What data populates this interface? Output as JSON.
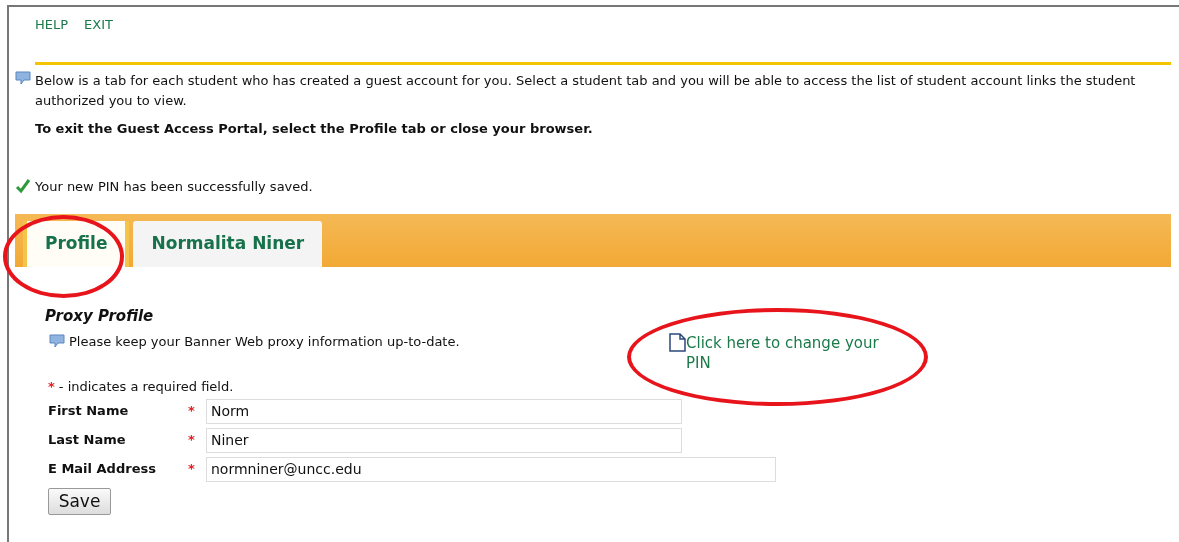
{
  "nav_links": [
    "HELP",
    "EXIT"
  ],
  "intro": "Below is a tab for each student who has created a guest account for you. Select a student tab and you will be able to access the list of student account links the student authorized you to view.",
  "exit_note": "To exit the Guest Access Portal, select the Profile tab or close your browser.",
  "success_message": "Your new PIN has been successfully saved.",
  "tabs": [
    {
      "label": "Profile",
      "selected": true
    },
    {
      "label": "Normalita Niner",
      "selected": false
    }
  ],
  "section": {
    "title": "Proxy Profile",
    "info": "Please keep your Banner Web proxy information up-to-date.",
    "pin_link": "Click here to change your PIN",
    "required_note": "- indicates a required field.",
    "required_mark": "*"
  },
  "fields": [
    {
      "label": "First Name",
      "value": "Norm",
      "required": true
    },
    {
      "label": "Last Name",
      "value": "Niner",
      "required": true
    },
    {
      "label": "E Mail Address",
      "value": "normniner@uncc.edu",
      "required": true
    }
  ],
  "save_button": "Save"
}
